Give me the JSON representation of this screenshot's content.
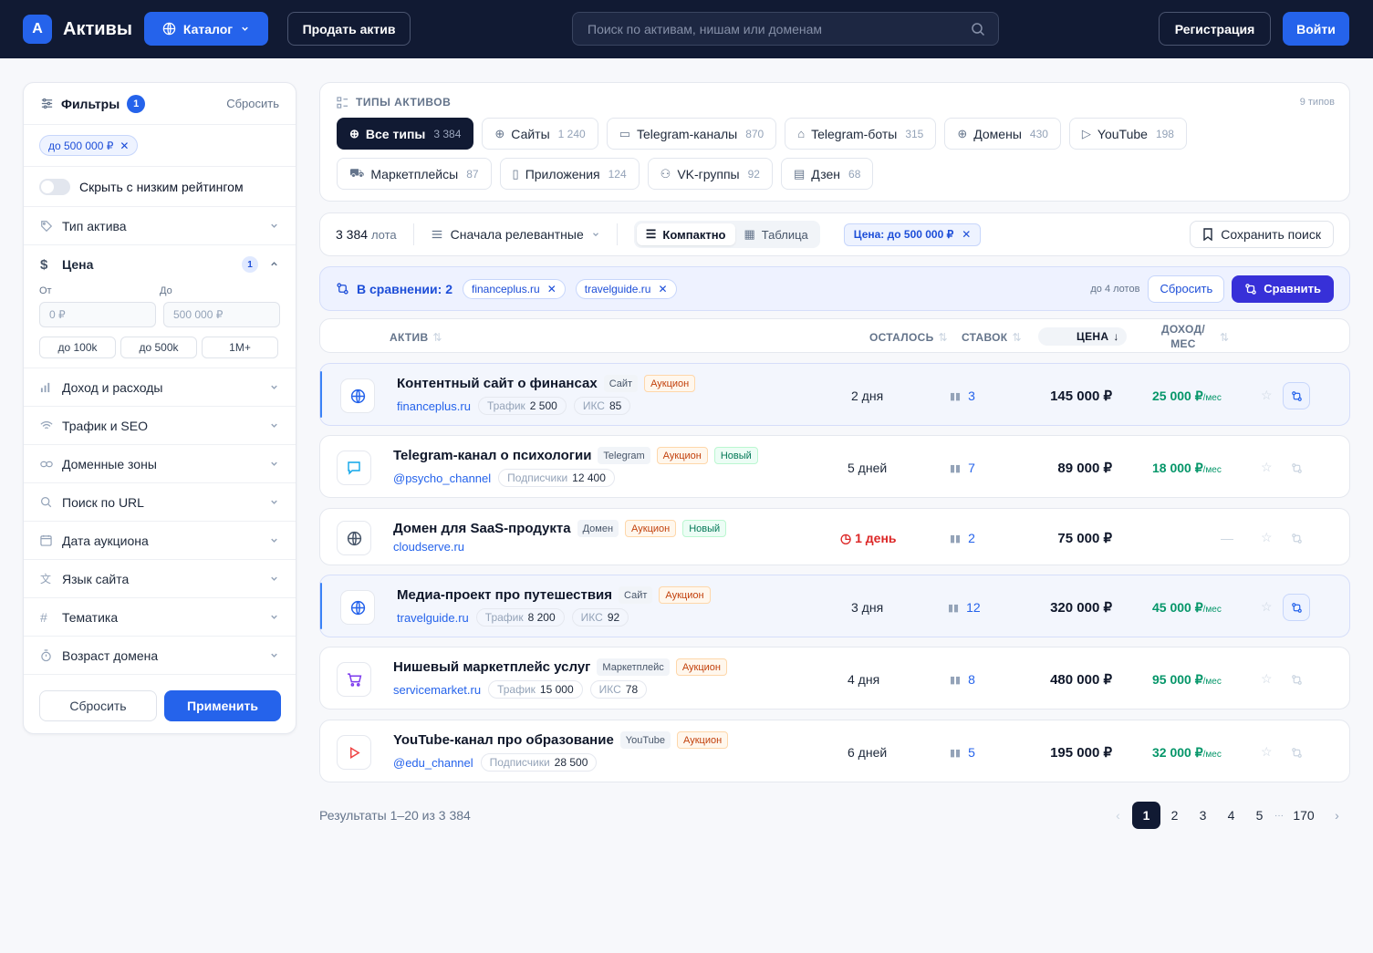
{
  "header": {
    "logo_letter": "А",
    "brand": "Активы",
    "catalog_label": "Каталог",
    "sell_label": "Продать актив",
    "search_placeholder": "Поиск по активам, нишам или доменам",
    "register_label": "Регистрация",
    "login_label": "Войти"
  },
  "sidebar": {
    "title": "Фильтры",
    "count": "1",
    "reset": "Сбросить",
    "active_chip": "до 500 000 ₽",
    "toggle_label": "Скрыть с низким рейтингом",
    "asset_type": "Тип актива",
    "price": {
      "label": "Цена",
      "count": "1",
      "from_label": "От",
      "to_label": "До",
      "from_value": "0 ₽",
      "to_value": "500 000 ₽",
      "quick": [
        "до 100k",
        "до 500k",
        "1M+"
      ]
    },
    "sections": [
      {
        "label": "Доход и расходы",
        "icon": "bar-chart-icon"
      },
      {
        "label": "Трафик и SEO",
        "icon": "wifi-icon"
      },
      {
        "label": "Доменные зоны",
        "icon": "link-icon"
      },
      {
        "label": "Поиск по URL",
        "icon": "search-icon"
      },
      {
        "label": "Дата аукциона",
        "icon": "calendar-icon"
      },
      {
        "label": "Язык сайта",
        "icon": "translate-icon"
      },
      {
        "label": "Тематика",
        "icon": "hash-icon"
      },
      {
        "label": "Возраст домена",
        "icon": "timer-icon"
      }
    ],
    "reset_button": "Сбросить",
    "apply_button": "Применить"
  },
  "types": {
    "heading": "ТИПЫ АКТИВОВ",
    "count": "9 типов",
    "items": [
      {
        "label": "Все типы",
        "n": "3 384",
        "active": true
      },
      {
        "label": "Сайты",
        "n": "1 240"
      },
      {
        "label": "Telegram-каналы",
        "n": "870"
      },
      {
        "label": "Telegram-боты",
        "n": "315"
      },
      {
        "label": "Домены",
        "n": "430"
      },
      {
        "label": "YouTube",
        "n": "198"
      },
      {
        "label": "Маркетплейсы",
        "n": "87"
      },
      {
        "label": "Приложения",
        "n": "124"
      },
      {
        "label": "VK-группы",
        "n": "92"
      },
      {
        "label": "Дзен",
        "n": "68"
      }
    ]
  },
  "toolbar": {
    "count": "3 384",
    "count_unit": "лота",
    "sort": "Сначала релевантные",
    "view_compact": "Компактно",
    "view_table": "Таблица",
    "price_chip": "Цена: до 500 000 ₽",
    "save": "Сохранить поиск"
  },
  "compare": {
    "label": "В сравнении: 2",
    "items": [
      "financeplus.ru",
      "travelguide.ru"
    ],
    "max": "до 4 лотов",
    "reset": "Сбросить",
    "go": "Сравнить"
  },
  "table": {
    "headers": {
      "asset": "АКТИВ",
      "left": "ОСТАЛОСЬ",
      "bids": "СТАВОК",
      "price": "ЦЕНА",
      "income_1": "ДОХОД/",
      "income_2": "МЕС"
    },
    "rows": [
      {
        "title": "Контентный сайт о финансах",
        "type": "Сайт",
        "auction": "Аукцион",
        "link": "financeplus.ru",
        "m1l": "Трафик",
        "m1v": "2 500",
        "m2l": "ИКС",
        "m2v": "85",
        "left": "2 дня",
        "bids": "3",
        "price": "145 000 ₽",
        "income": "25 000 ₽",
        "income_unit": "/мес"
      },
      {
        "title": "Telegram-канал о психологии",
        "type": "Telegram",
        "auction": "Аукцион",
        "new": "Новый",
        "link": "@psycho_channel",
        "m1l": "Подписчики",
        "m1v": "12 400",
        "left": "5 дней",
        "bids": "7",
        "price": "89 000 ₽",
        "income": "18 000 ₽",
        "income_unit": "/мес"
      },
      {
        "title": "Домен для SaaS-продукта",
        "type": "Домен",
        "auction": "Аукцион",
        "new": "Новый",
        "link": "cloudserve.ru",
        "left": "1 день",
        "bids": "2",
        "price": "75 000 ₽",
        "income": "—"
      },
      {
        "title": "Медиа-проект про путешествия",
        "type": "Сайт",
        "auction": "Аукцион",
        "link": "travelguide.ru",
        "m1l": "Трафик",
        "m1v": "8 200",
        "m2l": "ИКС",
        "m2v": "92",
        "left": "3 дня",
        "bids": "12",
        "price": "320 000 ₽",
        "income": "45 000 ₽",
        "income_unit": "/мес"
      },
      {
        "title": "Нишевый маркетплейс услуг",
        "type": "Маркетплейс",
        "auction": "Аукцион",
        "link": "servicemarket.ru",
        "m1l": "Трафик",
        "m1v": "15 000",
        "m2l": "ИКС",
        "m2v": "78",
        "left": "4 дня",
        "bids": "8",
        "price": "480 000 ₽",
        "income": "95 000 ₽",
        "income_unit": "/мес"
      },
      {
        "title": "YouTube-канал про образование",
        "type": "YouTube",
        "auction": "Аукцион",
        "link": "@edu_channel",
        "m1l": "Подписчики",
        "m1v": "28 500",
        "left": "6 дней",
        "bids": "5",
        "price": "195 000 ₽",
        "income": "32 000 ₽",
        "income_unit": "/мес"
      }
    ]
  },
  "footer": {
    "results": "Результаты 1–20 из 3 384",
    "pages": [
      "1",
      "2",
      "3",
      "4",
      "5",
      "···",
      "170"
    ]
  },
  "colors": {
    "accent": "#2563eb",
    "header_bg": "#111a33",
    "income": "#059669",
    "compare": "#3730d8"
  }
}
